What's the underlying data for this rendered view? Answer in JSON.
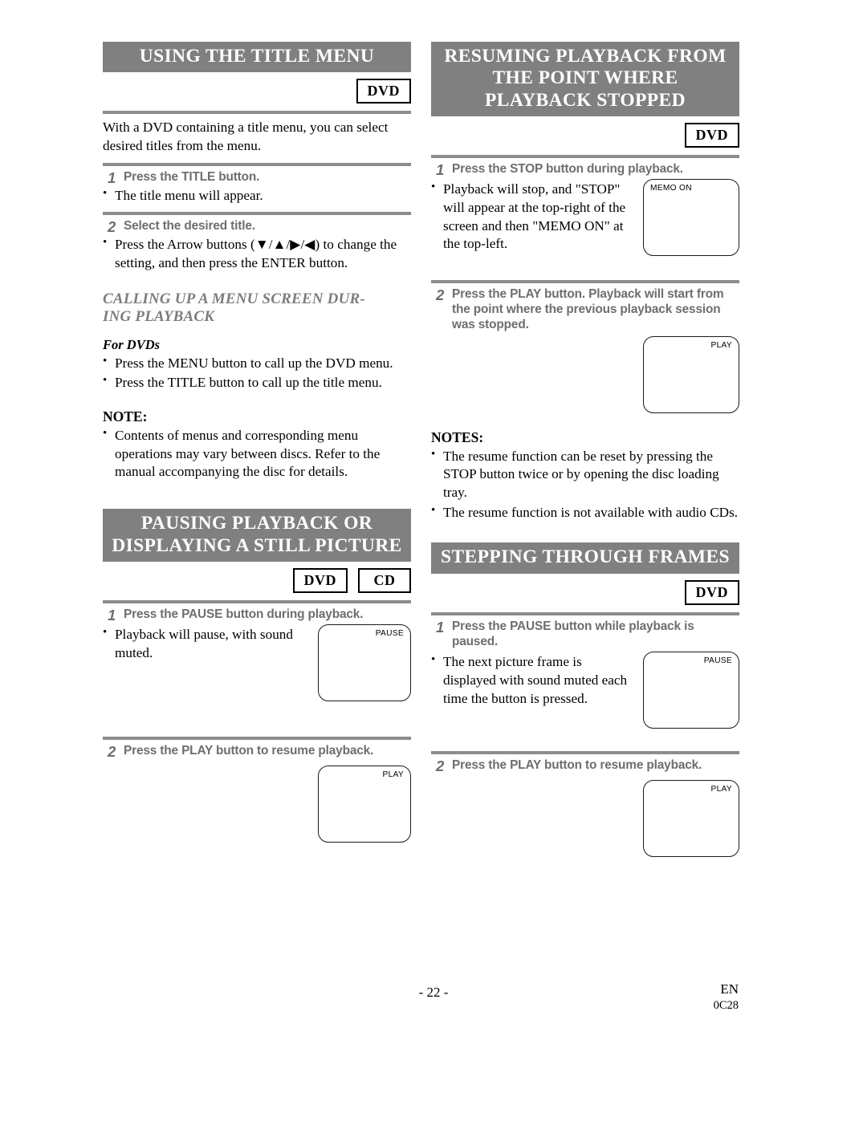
{
  "page": {
    "number_label": "- 22 -",
    "language_code": "EN",
    "doc_code": "0C28",
    "banner_color": "#808080",
    "rule_color": "#8c8c8c",
    "step_text_color": "#6e6e6e",
    "subhead_color": "#7d7d7d"
  },
  "left_column": {
    "section1": {
      "title_lines": [
        "USING THE TITLE MENU"
      ],
      "badges": [
        "DVD"
      ],
      "intro": "With a DVD containing a title menu, you can select desired titles from the menu.",
      "steps": [
        {
          "num": "1",
          "text": "Press the TITLE button.",
          "bullets": [
            "The title menu will appear."
          ]
        },
        {
          "num": "2",
          "text": "Select the desired title.",
          "bullets": [
            "Press the Arrow buttons (▼/▲/▶/◀) to change the setting, and then press the ENTER button."
          ]
        }
      ],
      "subhead_lines": [
        "CALLING UP A MENU SCREEN DUR-",
        "ING PLAYBACK"
      ],
      "minihead": "For DVDs",
      "minihead_bullets": [
        "Press the MENU button to call up the DVD menu.",
        "Press the TITLE button to call up the title menu."
      ],
      "note_head": "NOTE:",
      "note_bullets": [
        "Contents of menus and corresponding menu operations may vary between discs. Refer to the manual accompanying the disc for details."
      ]
    },
    "section2": {
      "title_lines": [
        "PAUSING PLAYBACK OR",
        "DISPLAYING A STILL PICTURE"
      ],
      "badges": [
        "DVD",
        "CD"
      ],
      "steps": [
        {
          "num": "1",
          "text": "Press the PAUSE button during playback.",
          "bullets": [
            "Playback will pause, with sound muted."
          ],
          "screen": {
            "label": "PAUSE",
            "label_position": "top-right"
          }
        },
        {
          "num": "2",
          "text": "Press the PLAY button to resume playback.",
          "bullets": [],
          "screen": {
            "label": "PLAY",
            "label_position": "top-right"
          }
        }
      ]
    }
  },
  "right_column": {
    "section1": {
      "title_lines": [
        "RESUMING PLAYBACK FROM",
        "THE POINT WHERE",
        "PLAYBACK STOPPED"
      ],
      "badges": [
        "DVD"
      ],
      "steps": [
        {
          "num": "1",
          "text": "Press the STOP button during playback.",
          "bullets": [
            "Playback will stop, and \"STOP\" will appear at the top-right of the screen and then \"MEMO ON\" at the top-left."
          ],
          "screen": {
            "label": "MEMO ON",
            "label_position": "top-left"
          }
        },
        {
          "num": "2",
          "text": "Press the PLAY button. Playback will start from the point where the previous playback session was stopped.",
          "bullets": [],
          "screen": {
            "label": "PLAY",
            "label_position": "top-right"
          }
        }
      ],
      "note_head": "NOTES:",
      "note_bullets": [
        "The resume function can be reset by pressing the STOP button twice or by opening the disc loading tray.",
        "The resume function is not available with audio CDs."
      ]
    },
    "section2": {
      "title_lines": [
        "STEPPING THROUGH FRAMES"
      ],
      "badges": [
        "DVD"
      ],
      "steps": [
        {
          "num": "1",
          "text": "Press the PAUSE button while playback is paused.",
          "bullets": [
            "The next picture frame is displayed with sound muted each time the button is pressed."
          ],
          "screen": {
            "label": "PAUSE",
            "label_position": "top-right"
          }
        },
        {
          "num": "2",
          "text": "Press the PLAY button to resume playback.",
          "bullets": [],
          "screen": {
            "label": "PLAY",
            "label_position": "top-right"
          }
        }
      ]
    }
  }
}
